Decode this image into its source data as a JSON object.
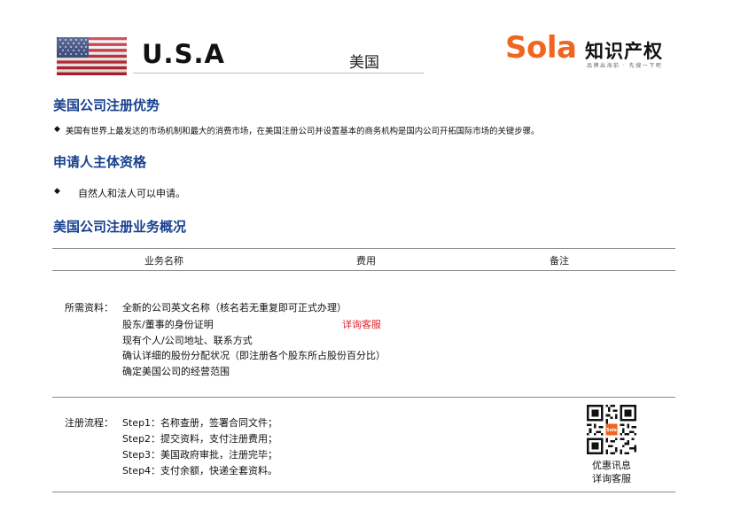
{
  "header": {
    "country_code": "U.S.A",
    "country_name_cn": "美国",
    "logo_name": "Sola",
    "logo_cn": "知识产权",
    "logo_tagline": "品牌出海前 · 先搜一下吧"
  },
  "sections": {
    "advantages_title": "美国公司注册优势",
    "advantages_text": "美国有世界上最发达的市场机制和最大的消费市场，在美国注册公司并设置基本的商务机构是国内公司开拓国际市场的关键步骤。",
    "eligibility_title": "申请人主体资格",
    "eligibility_text": "自然人和法人可以申请。",
    "overview_title": "美国公司注册业务概况"
  },
  "table": {
    "headers": [
      "业务名称",
      "费用",
      "备注"
    ],
    "materials_label": "所需资料：",
    "materials": [
      "全新的公司英文名称（核名若无重复即可正式办理）",
      "股东/董事的身份证明",
      "现有个人/公司地址、联系方式",
      "确认详细的股份分配状况（即注册各个股东所占股份百分比）",
      "确定美国公司的经营范围"
    ],
    "fee_text": "详询客服",
    "process_label": "注册流程：",
    "steps": [
      "Step1：名称查册，签署合同文件；",
      "Step2：提交资料，支付注册费用；",
      "Step3：美国政府审批，注册完毕；",
      "Step4：支付余额，快递全套资料。"
    ],
    "qr_caption_1": "优惠讯息",
    "qr_caption_2": "详询客服",
    "qr_badge": "Sola"
  },
  "colors": {
    "brand_orange": "#f0661e",
    "heading_blue": "#17408f",
    "alert_red": "#e0212a"
  },
  "icons": [
    "usa-flag-icon",
    "diamond-bullet-icon",
    "qr-code-icon"
  ]
}
